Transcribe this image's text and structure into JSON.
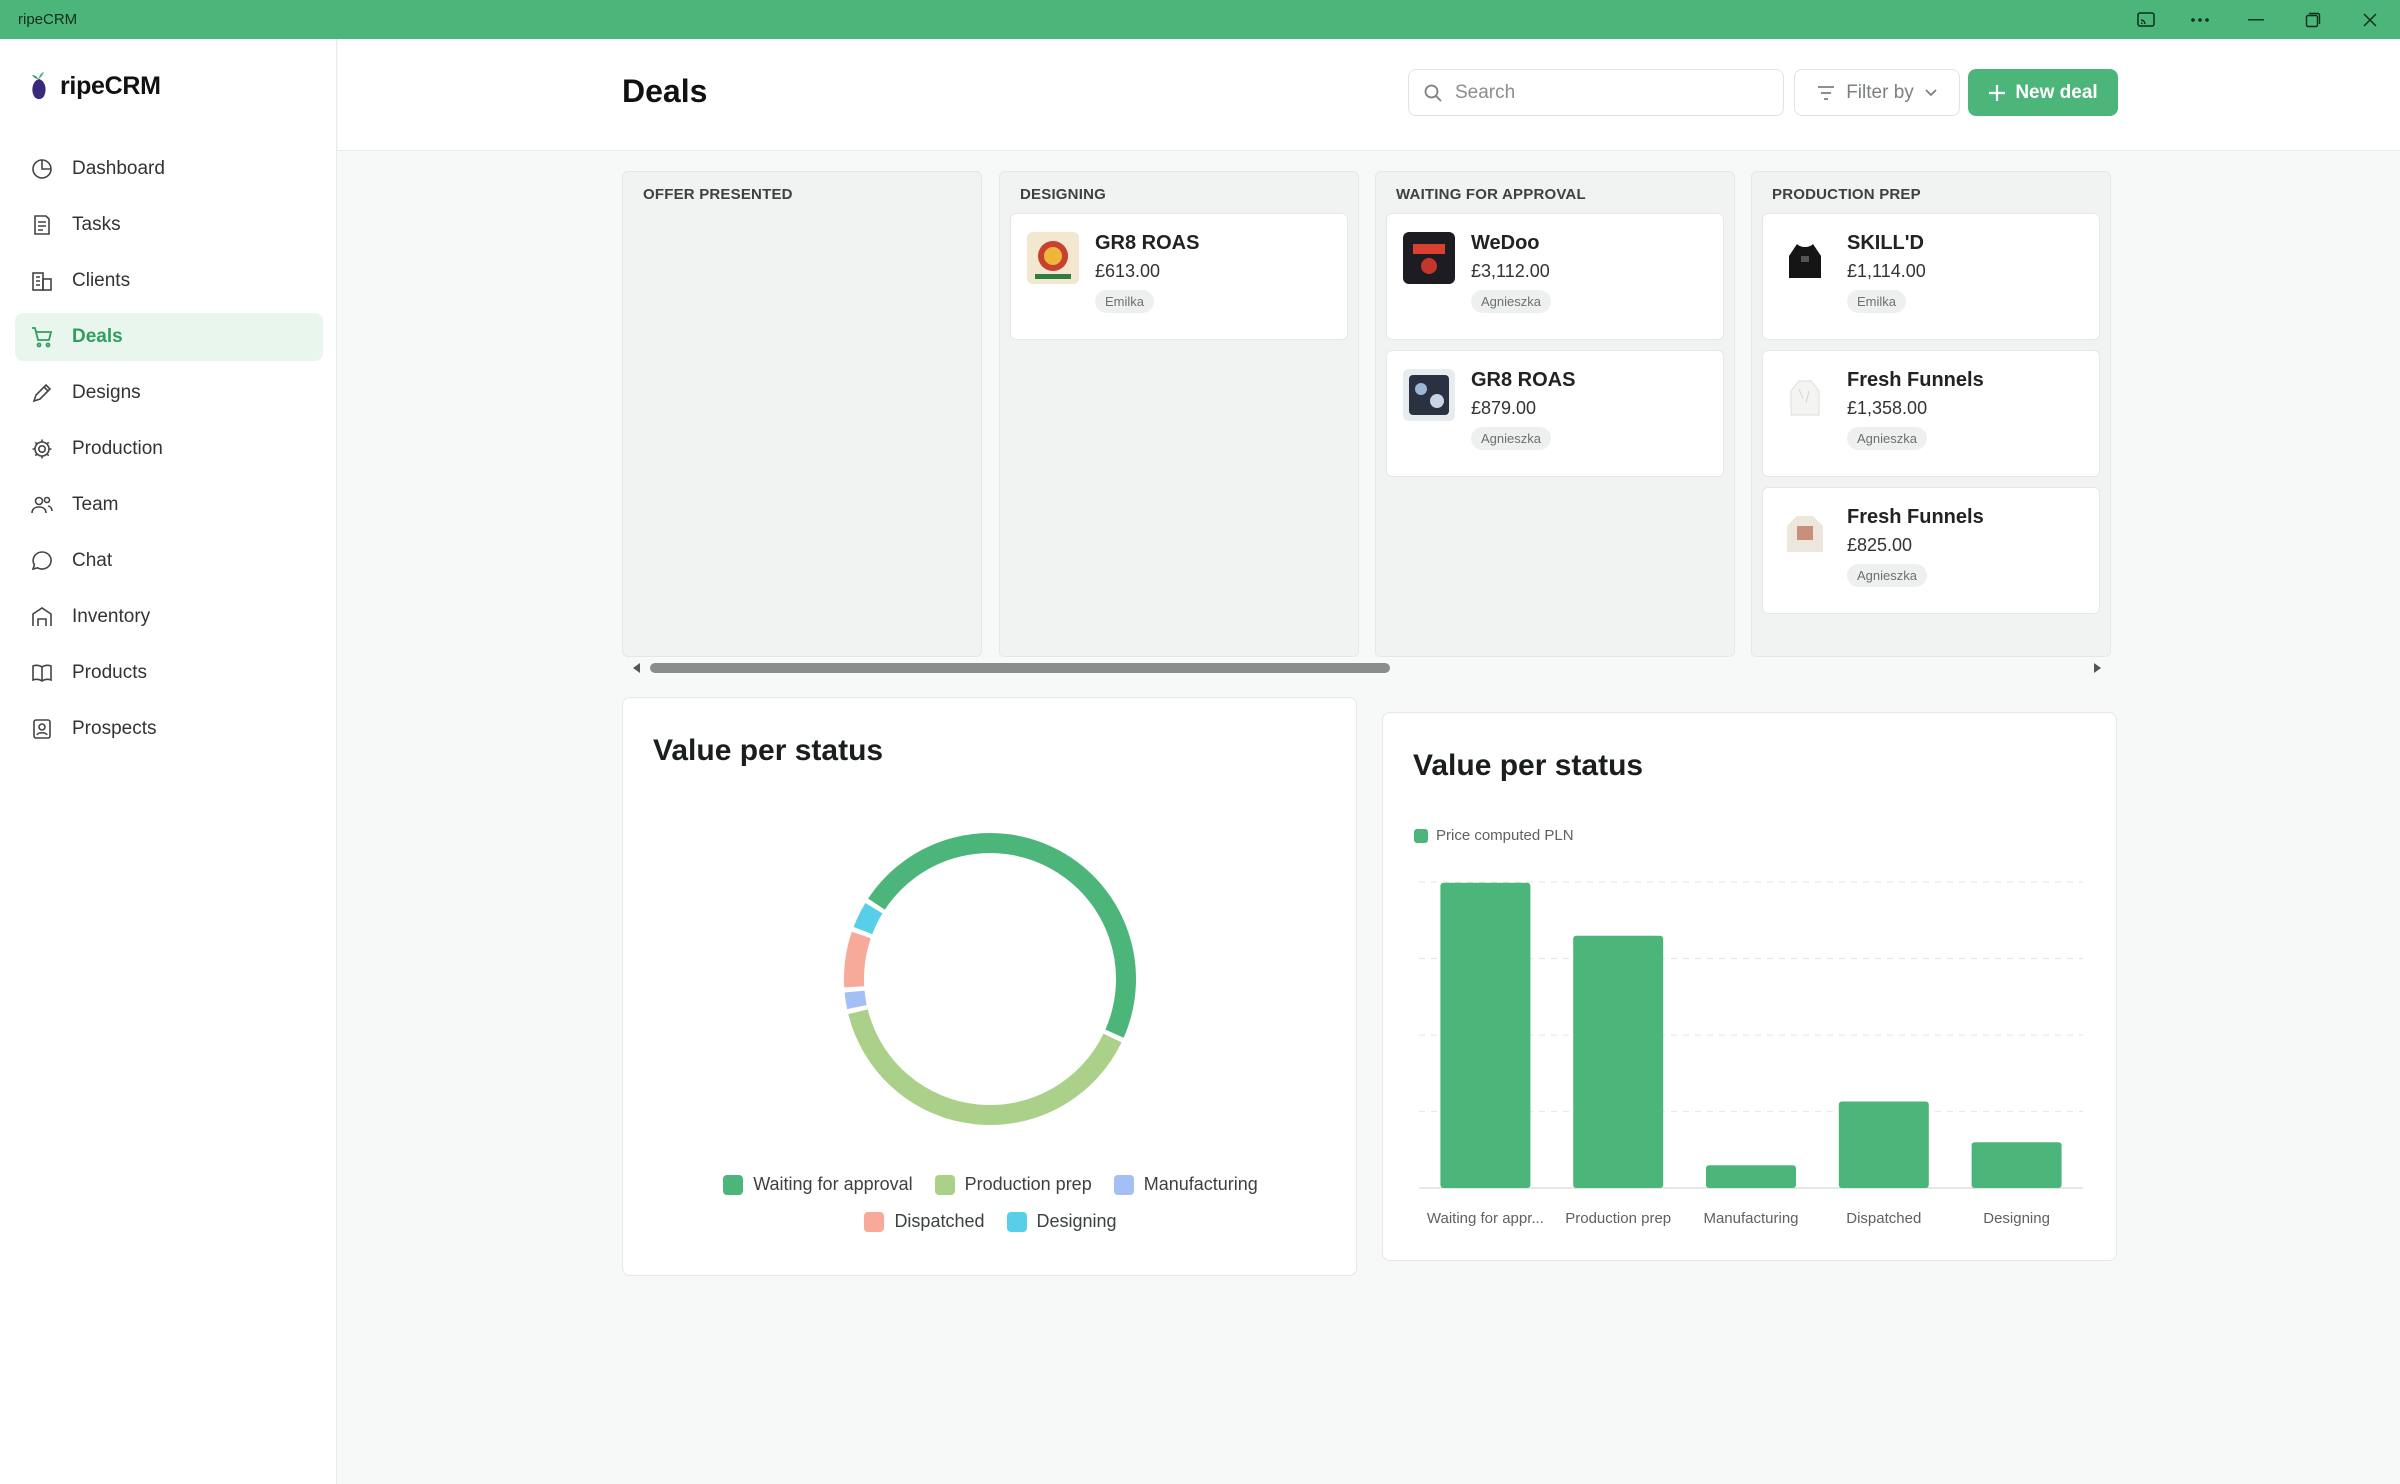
{
  "window": {
    "title": "ripeCRM"
  },
  "brand": {
    "name": "ripeCRM"
  },
  "sidebar": {
    "items": [
      {
        "label": "Dashboard",
        "icon": "dashboard-icon"
      },
      {
        "label": "Tasks",
        "icon": "tasks-icon"
      },
      {
        "label": "Clients",
        "icon": "clients-icon"
      },
      {
        "label": "Deals",
        "icon": "cart-icon",
        "active": true
      },
      {
        "label": "Designs",
        "icon": "pen-icon"
      },
      {
        "label": "Production",
        "icon": "gear-icon"
      },
      {
        "label": "Team",
        "icon": "team-icon"
      },
      {
        "label": "Chat",
        "icon": "chat-icon"
      },
      {
        "label": "Inventory",
        "icon": "warehouse-icon"
      },
      {
        "label": "Products",
        "icon": "book-icon"
      },
      {
        "label": "Prospects",
        "icon": "contact-icon"
      }
    ]
  },
  "header": {
    "title": "Deals",
    "search_placeholder": "Search",
    "filter_label": "Filter by",
    "new_deal_label": "New deal"
  },
  "board": {
    "columns": [
      {
        "title": "OFFER PRESENTED",
        "cards": []
      },
      {
        "title": "DESIGNING",
        "cards": [
          {
            "name": "GR8 ROAS",
            "price": "£613.00",
            "assignee": "Emilka"
          }
        ]
      },
      {
        "title": "WAITING FOR APPROVAL",
        "cards": [
          {
            "name": "WeDoo",
            "price": "£3,112.00",
            "assignee": "Agnieszka"
          },
          {
            "name": "GR8 ROAS",
            "price": "£879.00",
            "assignee": "Agnieszka"
          }
        ]
      },
      {
        "title": "PRODUCTION PREP",
        "cards": [
          {
            "name": "SKILL'D",
            "price": "£1,114.00",
            "assignee": "Emilka"
          },
          {
            "name": "Fresh Funnels",
            "price": "£1,358.00",
            "assignee": "Agnieszka"
          },
          {
            "name": "Fresh Funnels",
            "price": "£825.00",
            "assignee": "Agnieszka"
          }
        ]
      }
    ]
  },
  "colors": {
    "accent": "#4cb57a",
    "waiting": "#4cb57a",
    "production_prep": "#abd08a",
    "manufacturing": "#a3bff5",
    "dispatched": "#f7a99a",
    "designing": "#57cfe8"
  },
  "chart_data": [
    {
      "type": "pie",
      "variant": "donut",
      "title": "Value per status",
      "categories": [
        "Waiting for approval",
        "Production prep",
        "Manufacturing",
        "Dispatched",
        "Designing"
      ],
      "values": [
        3991,
        3297,
        200,
        560,
        290
      ],
      "legend": "bottom"
    },
    {
      "type": "bar",
      "title": "Value per status",
      "categories": [
        "Waiting for appr...",
        "Production prep",
        "Manufacturing",
        "Dispatched",
        "Designing"
      ],
      "series": [
        {
          "name": "Price computed PLN",
          "values": [
            3991,
            3297,
            297,
            1130,
            598
          ]
        }
      ],
      "ylim": [
        0,
        4000
      ],
      "grid": true,
      "legend": "top-left"
    }
  ]
}
